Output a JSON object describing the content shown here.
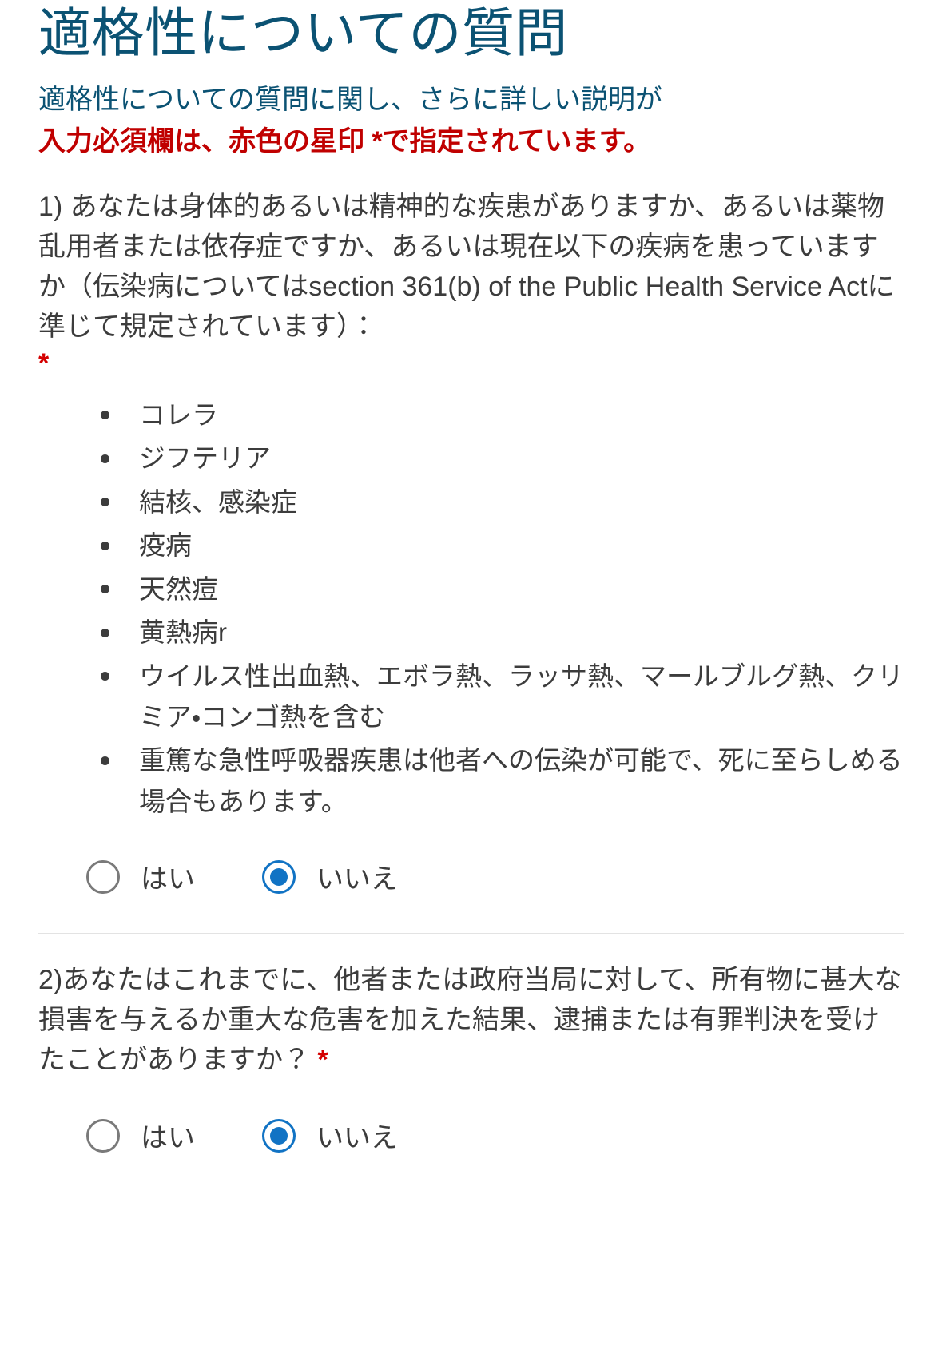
{
  "header": {
    "title": "適格性についての質問",
    "intro_line": "適格性についての質問に関し、さらに詳しい説明が",
    "required_notice": "入力必須欄は、赤色の星印 *で指定されています。"
  },
  "questions": [
    {
      "number": "1)",
      "text": "1) あなたは身体的あるいは精神的な疾患がありますか、あるいは薬物乱用者または依存症ですか、あるいは現在以下の疾病を患っていますか（伝染病についてはsection 361(b) of the Public Health Service Actに準じて規定されています）：",
      "required_marker": "*",
      "bullets": [
        "コレラ",
        "ジフテリア",
        "結核、感染症",
        "疫病",
        "天然痘",
        "黄熱病r",
        "ウイルス性出血熱、エボラ熱、ラッサ熱、マールブルグ熱、クリミア・コンゴ熱を含む",
        "重篤な急性呼吸器疾患は他者への伝染が可能で、死に至らしめる場合もあります。"
      ],
      "options": [
        {
          "label": "はい",
          "selected": false
        },
        {
          "label": "いいえ",
          "selected": true
        }
      ]
    },
    {
      "number": "2)",
      "text": "2)あなたはこれまでに、他者または政府当局に対して、所有物に甚大な損害を与えるか重大な危害を加えた結果、逮捕または有罪判決を受けたことがありますか？",
      "required_marker": "*",
      "bullets": [],
      "options": [
        {
          "label": "はい",
          "selected": false
        },
        {
          "label": "いいえ",
          "selected": true
        }
      ]
    }
  ],
  "colors": {
    "title_blue": "#0b5273",
    "required_red": "#c00000",
    "star_red": "#d40000",
    "body_text": "#3c3c3c",
    "radio_selected": "#1173c4",
    "radio_unselected": "#7a7a7a",
    "divider": "#e3e3e3"
  }
}
